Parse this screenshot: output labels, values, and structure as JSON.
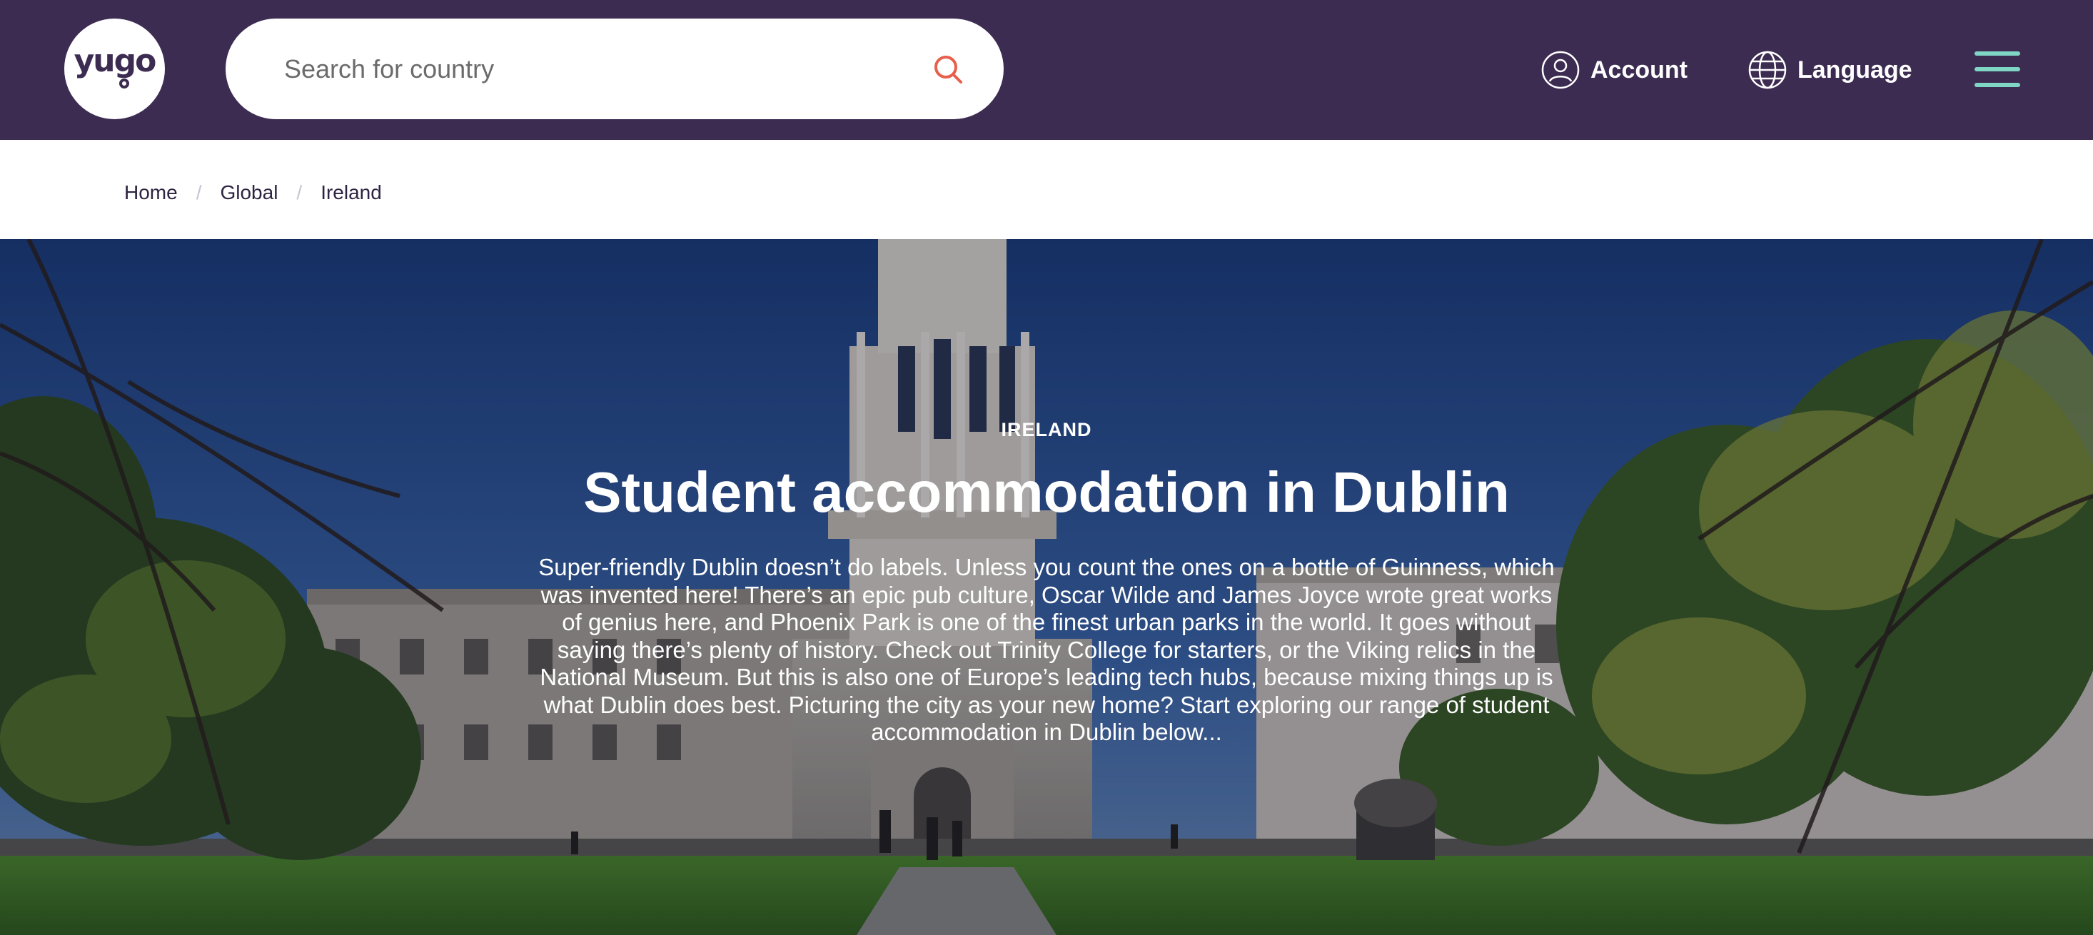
{
  "brand": {
    "logo_text": "yugo",
    "colors": {
      "header_bg": "#3d2c52",
      "menu_accent": "#7fd6c4",
      "search_icon": "#e8604c"
    }
  },
  "header": {
    "search": {
      "placeholder": "Search for country",
      "icon": "search-icon"
    },
    "account": {
      "label": "Account",
      "icon": "user-circle-icon"
    },
    "language": {
      "label": "Language",
      "icon": "globe-icon"
    },
    "menu": {
      "icon": "hamburger-menu-icon"
    }
  },
  "breadcrumb": {
    "items": [
      "Home",
      "Global",
      "Ireland"
    ],
    "separator": "/"
  },
  "hero": {
    "eyebrow": "IRELAND",
    "title": "Student accommodation in Dublin",
    "description": "Super-friendly Dublin doesn’t do labels. Unless you count the ones on a bottle of Guinness, which was invented here! There’s an epic pub culture, Oscar Wilde and James Joyce wrote great works of genius here, and Phoenix Park is one of the finest urban parks in the world. It goes without saying there’s plenty of history. Check out Trinity College for starters, or the Viking relics in the National Museum. But this is also one of Europe’s leading tech hubs, because mixing things up is what Dublin does best. Picturing the city as your new home? Start exploring our range of student accommodation in Dublin below..."
  }
}
